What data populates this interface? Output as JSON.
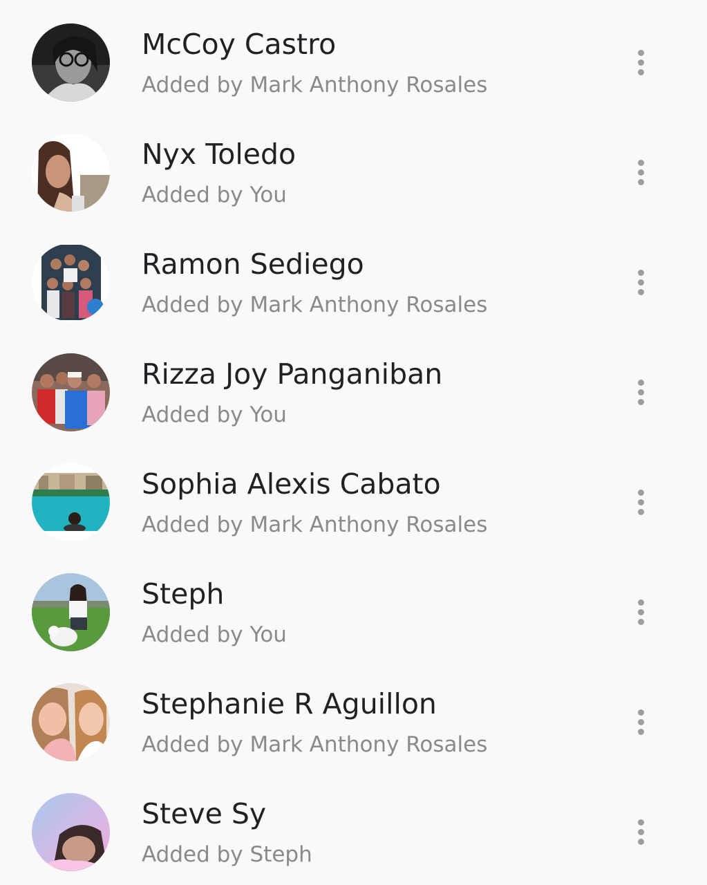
{
  "members": [
    {
      "name": "McCoy Castro",
      "added_by": "Added by Mark Anthony Rosales",
      "avatar_icon": "profile-photo"
    },
    {
      "name": "Nyx Toledo",
      "added_by": "Added by You",
      "avatar_icon": "profile-photo"
    },
    {
      "name": "Ramon Sediego",
      "added_by": "Added by Mark Anthony Rosales",
      "avatar_icon": "profile-photo"
    },
    {
      "name": "Rizza Joy Panganiban",
      "added_by": "Added by You",
      "avatar_icon": "profile-photo"
    },
    {
      "name": "Sophia Alexis Cabato",
      "added_by": "Added by Mark Anthony Rosales",
      "avatar_icon": "profile-photo"
    },
    {
      "name": "Steph",
      "added_by": "Added by You",
      "avatar_icon": "profile-photo"
    },
    {
      "name": "Stephanie R Aguillon",
      "added_by": "Added by Mark Anthony Rosales",
      "avatar_icon": "profile-photo"
    },
    {
      "name": "Steve Sy",
      "added_by": "Added by Steph",
      "avatar_icon": "profile-photo"
    }
  ],
  "more_icon": "more-vertical-icon"
}
